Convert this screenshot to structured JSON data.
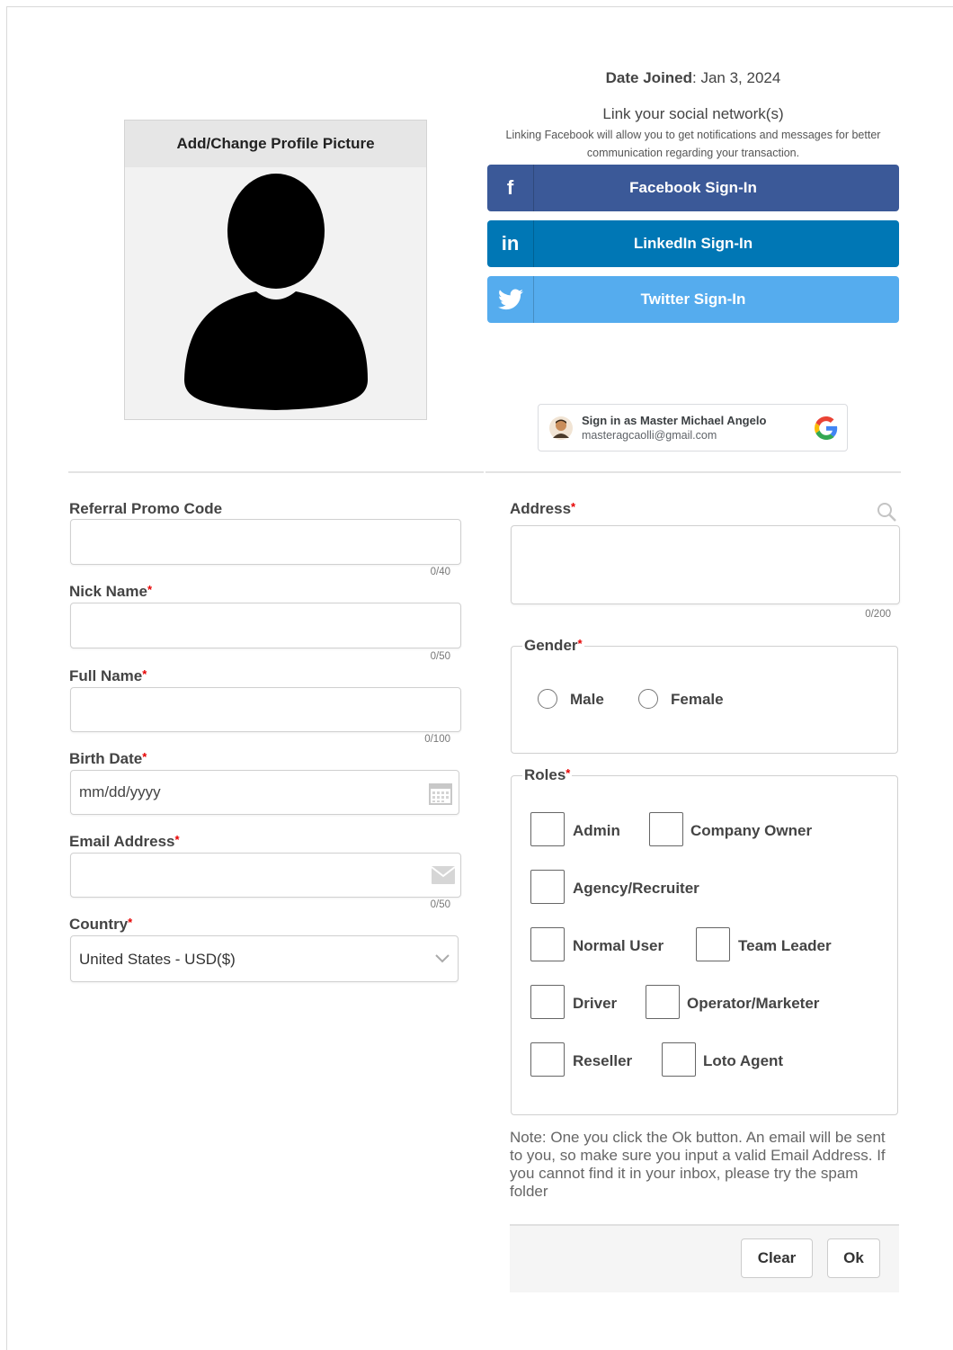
{
  "profile": {
    "picture_header": "Add/Change Profile Picture"
  },
  "date_joined": {
    "label": "Date Joined",
    "value": ": Jan 3, 2024"
  },
  "social": {
    "title": "Link your social network(s)",
    "description": "Linking Facebook will allow you to get notifications and messages for better communication regarding your transaction.",
    "buttons": [
      {
        "label": "Facebook Sign-In",
        "icon": "facebook-icon",
        "color": "#3b5998"
      },
      {
        "label": "LinkedIn Sign-In",
        "icon": "linkedin-icon",
        "color": "#0077b5"
      },
      {
        "label": "Twitter Sign-In",
        "icon": "twitter-icon",
        "color": "#55acee"
      }
    ],
    "google": {
      "name": "Sign in as Master Michael Angelo",
      "email": "masteragcaolli@gmail.com"
    }
  },
  "form": {
    "referral": {
      "label": "Referral Promo Code",
      "value": "",
      "counter": "0/40"
    },
    "nick_name": {
      "label": "Nick Name",
      "value": "",
      "counter": "0/50"
    },
    "full_name": {
      "label": "Full Name",
      "value": "",
      "counter": "0/100"
    },
    "birth_date": {
      "label": "Birth Date",
      "placeholder": "mm/dd/yyyy"
    },
    "email": {
      "label": "Email Address",
      "value": "",
      "counter": "0/50"
    },
    "country": {
      "label": "Country",
      "selected": "United States - USD($)"
    },
    "address": {
      "label": "Address",
      "value": "",
      "counter": "0/200"
    },
    "required_mark": "*",
    "gender": {
      "legend": "Gender",
      "options": [
        "Male",
        "Female"
      ]
    },
    "roles": {
      "legend": "Roles",
      "options": [
        "Admin",
        "Company Owner",
        "Agency/Recruiter",
        "Normal User",
        "Team Leader",
        "Driver",
        "Operator/Marketer",
        "Reseller",
        "Loto Agent"
      ]
    },
    "note": "Note: One you click the Ok button. An email will be sent to you, so make sure you input a valid Email Address. If you cannot find it in your inbox, please try the spam folder",
    "buttons": {
      "clear": "Clear",
      "ok": "Ok"
    }
  }
}
